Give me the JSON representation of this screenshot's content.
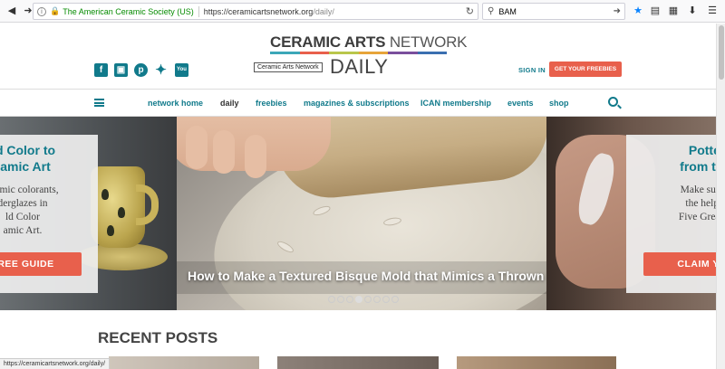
{
  "browser": {
    "identity": "The American Ceramic Society (US)",
    "url_host": "https://ceramicartsnetwork.org",
    "url_path": "/daily/",
    "search_value": "BAM",
    "status_url": "https://ceramicartsnetwork.org/daily/"
  },
  "header": {
    "logo_main": "CERAMIC ARTS",
    "logo_net": " NETWORK",
    "logo_badge": "Ceramic Arts Network",
    "daily": "DAILY",
    "signin": "SIGN IN",
    "freebies_button": "GET YOUR FREEBIES",
    "stripe_colors": [
      "#3ca7b8",
      "#e8604c",
      "#b9c64b",
      "#e7a43a",
      "#7a4f9c",
      "#3b6fb0"
    ]
  },
  "social": [
    {
      "icon": "facebook-icon",
      "glyph": "f"
    },
    {
      "icon": "instagram-icon",
      "glyph": "◘"
    },
    {
      "icon": "pinterest-icon",
      "glyph": "p"
    },
    {
      "icon": "twitter-icon",
      "glyph": "🐦"
    },
    {
      "icon": "youtube-icon",
      "glyph": "You"
    }
  ],
  "nav": {
    "items": [
      {
        "label": "network home",
        "name": "nav-network-home"
      },
      {
        "label": "daily",
        "name": "nav-daily"
      },
      {
        "label": "freebies",
        "name": "nav-freebies"
      },
      {
        "label": "magazines & subscriptions",
        "name": "nav-magazines"
      },
      {
        "label": "ICAN membership",
        "name": "nav-ican"
      },
      {
        "label": "events",
        "name": "nav-events"
      },
      {
        "label": "shop",
        "name": "nav-shop"
      }
    ]
  },
  "carousel": {
    "left_card": {
      "title": "d Color to\namic Art",
      "desc": "eramic colorants,\nderglazes in\nld Color\namic Art.",
      "button": "FREE GUIDE"
    },
    "center_caption": "How to Make a Textured Bisque Mold that Mimics a Thrown Pie",
    "right_card": {
      "title": "Pottery\nfrom the e",
      "desc": "Make surfaces\nthe help of t\nFive Great Dec",
      "button": "CLAIM YO"
    },
    "dots_total": 8,
    "active_dot": 3
  },
  "recent_posts": {
    "heading": "RECENT POSTS"
  },
  "colors": {
    "teal": "#117a8b",
    "orange": "#e8604c"
  }
}
